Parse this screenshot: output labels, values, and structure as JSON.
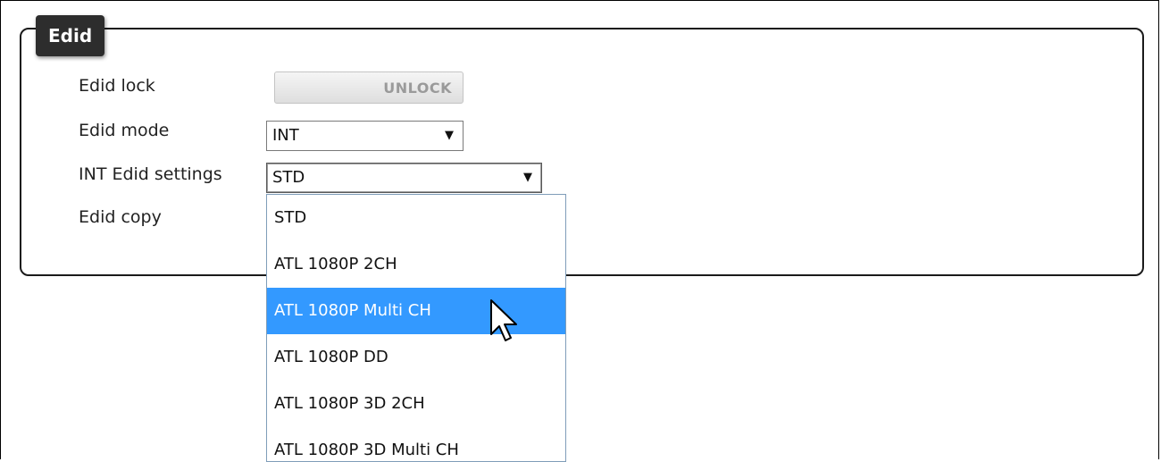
{
  "panel": {
    "title": "Edid"
  },
  "rows": {
    "edid_lock": {
      "label": "Edid lock",
      "button_label": "UNLOCK"
    },
    "edid_mode": {
      "label": "Edid mode",
      "value": "INT"
    },
    "int_edid_settings": {
      "label": "INT Edid settings",
      "value": "STD"
    },
    "edid_copy": {
      "label": "Edid copy"
    }
  },
  "dropdown": {
    "options": [
      "STD",
      "ATL 1080P 2CH",
      "ATL 1080P Multi CH",
      "ATL 1080P DD",
      "ATL 1080P 3D 2CH",
      "ATL 1080P 3D Multi CH"
    ],
    "highlighted_option": "ATL 1080P Multi CH"
  },
  "colors": {
    "highlight": "#3399ff",
    "panel_title_bg": "#2d2d2d"
  },
  "icons": {
    "select_arrow": "caret-down-icon",
    "cursor": "arrow-pointer-icon"
  }
}
